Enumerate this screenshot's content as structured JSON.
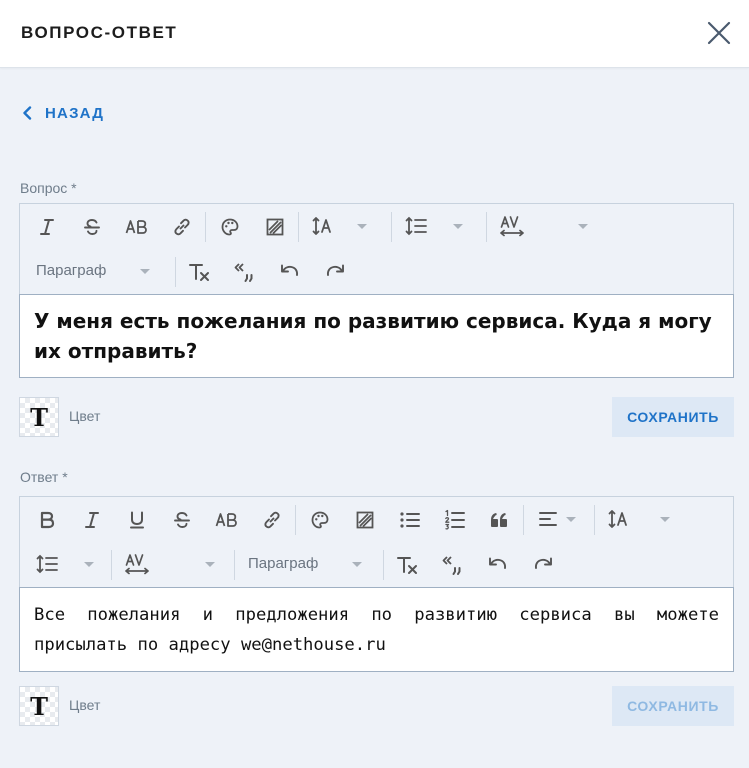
{
  "header": {
    "title": "ВОПРОС-ОТВЕТ",
    "close_icon": "close-icon"
  },
  "back": {
    "label": "НАЗАД",
    "icon": "chevron-left-icon"
  },
  "question": {
    "label": "Вопрос *",
    "text": "У меня есть пожелания по развитию сервиса. Куда я могу их отправить?",
    "paragraph_select": "Параграф",
    "color_label": "Цвет",
    "color_swatch_glyph": "T",
    "save_label": "СОХРАНИТЬ",
    "save_color": "#1f73c8"
  },
  "answer": {
    "label": "Ответ *",
    "text": "Все пожелания и предложения по развитию сервиса вы можете присылать по адресу we@nethouse.ru",
    "paragraph_select": "Параграф",
    "color_label": "Цвет",
    "color_swatch_glyph": "T",
    "save_label": "СОХРАНИТЬ",
    "save_color": "#8fb9e2"
  },
  "colors": {
    "accent": "#1f73c8",
    "background": "#eef2f8",
    "border": "#9fb0c3"
  }
}
